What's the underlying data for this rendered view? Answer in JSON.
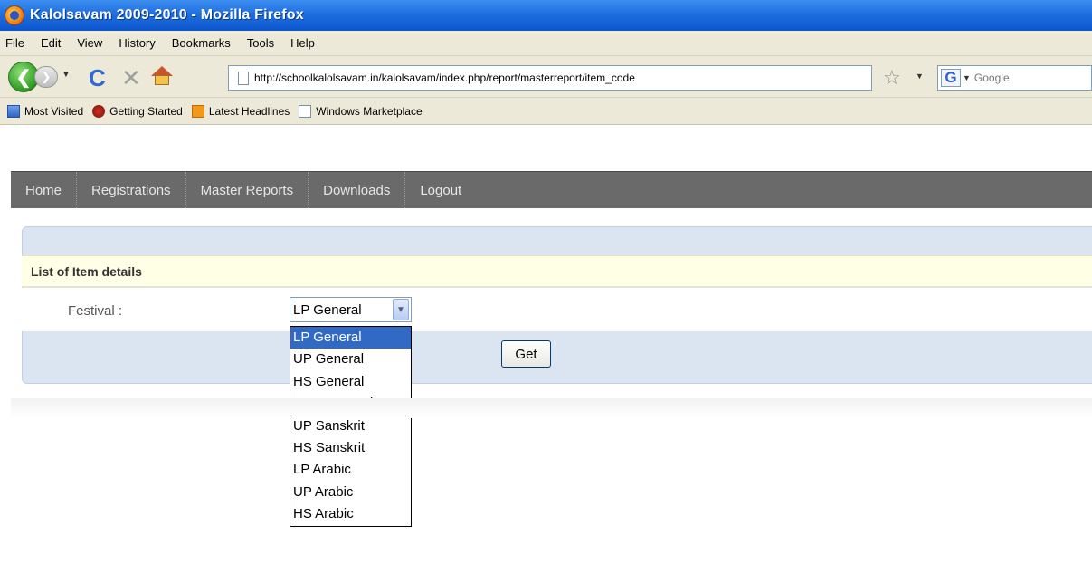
{
  "window": {
    "title": "Kalolsavam 2009-2010 - Mozilla Firefox"
  },
  "menubar": {
    "items": [
      "File",
      "Edit",
      "View",
      "History",
      "Bookmarks",
      "Tools",
      "Help"
    ]
  },
  "toolbar": {
    "back_icon": "back-arrow-icon",
    "forward_icon": "forward-arrow-icon",
    "reload_glyph": "C",
    "stop_glyph": "✕",
    "url": "http://schoolkalolsavam.in/kalolsavam/index.php/report/masterreport/item_code",
    "search_engine_glyph": "G",
    "search_placeholder": "Google"
  },
  "bookmarks": {
    "items": [
      "Most Visited",
      "Getting Started",
      "Latest Headlines",
      "Windows Marketplace"
    ]
  },
  "site_nav": {
    "items": [
      "Home",
      "Registrations",
      "Master Reports",
      "Downloads",
      "Logout"
    ]
  },
  "report": {
    "heading": "List of Item details",
    "festival_label": "Festival :",
    "festival_selected": "LP General",
    "festival_options": [
      "LP General",
      "UP General",
      "HS General",
      "HSS General",
      "UP Sanskrit",
      "HS Sanskrit",
      "LP Arabic",
      "UP Arabic",
      "HS Arabic"
    ],
    "get_label": "Get"
  },
  "colors": {
    "titlebar": "#1f6fe0",
    "chrome": "#ece9d8",
    "site_nav": "#6a6a6a",
    "panel": "#dbe5f1",
    "panel_header": "#ffffe6",
    "selection": "#316ac5"
  }
}
